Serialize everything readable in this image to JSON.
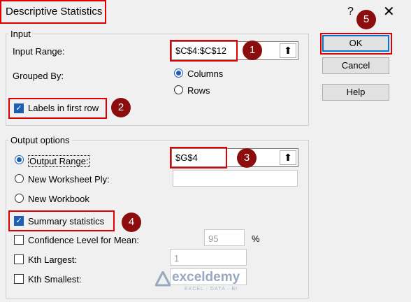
{
  "dialog": {
    "title": "Descriptive Statistics",
    "help_glyph": "?",
    "close_glyph": "✕"
  },
  "input_group": {
    "legend": "Input",
    "input_range_label": "Input Range:",
    "input_range_value": "$C$4:$C$12",
    "grouped_by_label": "Grouped By:",
    "columns_label": "Columns",
    "rows_label": "Rows",
    "labels_first_row_label": "Labels in first row"
  },
  "output_group": {
    "legend": "Output options",
    "output_range_label": "Output Range:",
    "output_range_value": "$G$4",
    "new_worksheet_label": "New Worksheet Ply:",
    "new_workbook_label": "New Workbook",
    "summary_label": "Summary statistics",
    "confidence_label": "Confidence Level for Mean:",
    "confidence_value": "95",
    "percent": "%",
    "kth_largest_label": "Kth Largest:",
    "kth_largest_value": "1",
    "kth_smallest_label": "Kth Smallest:"
  },
  "buttons": {
    "ok": "OK",
    "cancel": "Cancel",
    "help": "Help"
  },
  "badges": [
    "1",
    "2",
    "3",
    "4",
    "5"
  ],
  "icons": {
    "ref_button": "collapse-dialog-icon",
    "check": "✓"
  },
  "watermark": {
    "name": "exceldemy",
    "tagline": "EXCEL · DATA · BI"
  },
  "colors": {
    "highlight": "#e00000",
    "badge": "#8b0d0d",
    "accent": "#1e5fb4"
  }
}
